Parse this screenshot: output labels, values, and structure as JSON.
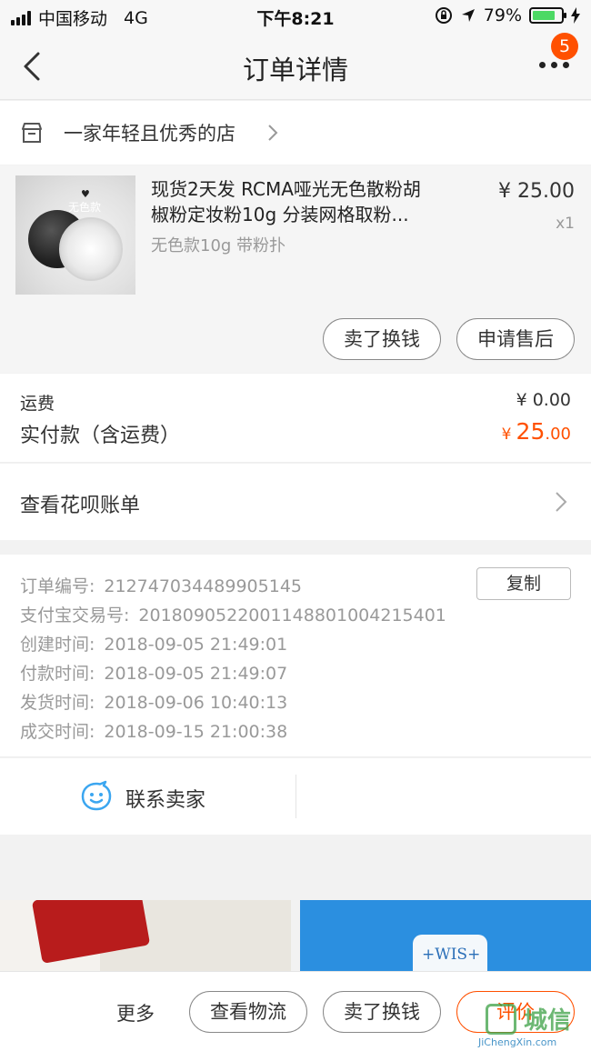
{
  "status_bar": {
    "carrier": "中国移动",
    "network": "4G",
    "time": "下午8:21",
    "battery_percent": "79%",
    "battery_level": 0.79
  },
  "nav": {
    "title": "订单详情",
    "more_badge": "5"
  },
  "shop": {
    "name": "一家年轻且优秀的店"
  },
  "product": {
    "title_line1": "现货2天发 RCMA哑光无色散粉胡",
    "title_line2": "椒粉定妆粉10g 分装网格取粉...",
    "sku": "无色款10g 带粉扑",
    "price": "¥ 25.00",
    "quantity": "x1",
    "thumb_label": "无色款",
    "actions": [
      "卖了换钱",
      "申请售后"
    ]
  },
  "fees": {
    "shipping_label": "运费",
    "shipping_value": "¥ 0.00",
    "paid_label": "实付款（含运费）",
    "paid_currency": "¥",
    "paid_integer": "25",
    "paid_decimal": ".00"
  },
  "huabei": {
    "label": "查看花呗账单"
  },
  "order_info": {
    "copy_label": "复制",
    "rows": [
      {
        "key": "订单编号:",
        "value": "212747034489905145"
      },
      {
        "key": "支付宝交易号:",
        "value": "2018090522001148801004215401"
      },
      {
        "key": "创建时间:",
        "value": "2018-09-05 21:49:01"
      },
      {
        "key": "付款时间:",
        "value": "2018-09-05 21:49:07"
      },
      {
        "key": "发货时间:",
        "value": "2018-09-06 10:40:13"
      },
      {
        "key": "成交时间:",
        "value": "2018-09-15 21:00:38"
      }
    ]
  },
  "contact": {
    "label": "联系卖家"
  },
  "recommend": {
    "right_text": "+WIS+"
  },
  "bottom_bar": {
    "more": "更多",
    "logistics": "查看物流",
    "sell": "卖了换钱",
    "evaluate": "评价"
  },
  "watermark": {
    "text": "城信",
    "url": "JiChengXin.com"
  },
  "colors": {
    "accent": "#ff5000",
    "battery": "#4cd964",
    "contact_icon": "#3ba6f0"
  }
}
